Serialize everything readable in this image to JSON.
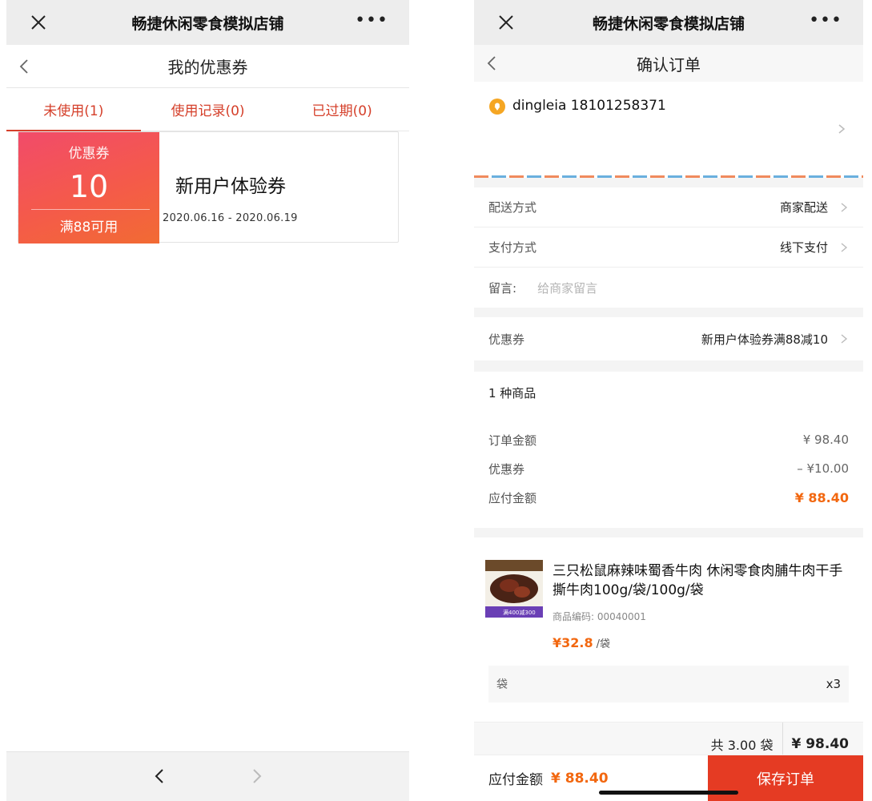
{
  "left": {
    "wx_title": "畅捷休闲零食模拟店铺",
    "more": "•••",
    "nav_title": "我的优惠券",
    "tabs": [
      {
        "label": "未使用(1)"
      },
      {
        "label": "使用记录(0)"
      },
      {
        "label": "已过期(0)"
      }
    ],
    "coupon": {
      "label": "优惠券",
      "amount": "10",
      "condition": "满88可用",
      "name": "新用户体验券",
      "date_range": "2020.06.16 - 2020.06.19"
    }
  },
  "right": {
    "wx_title": "畅捷休闲零食模拟店铺",
    "more": "•••",
    "nav_title": "确认订单",
    "address": {
      "who": "dingleia 18101258371"
    },
    "delivery": {
      "label": "配送方式",
      "value": "商家配送"
    },
    "payment": {
      "label": "支付方式",
      "value": "线下支付"
    },
    "message": {
      "label": "留言:",
      "placeholder": "给商家留言"
    },
    "coupon": {
      "label": "优惠券",
      "value": "新用户体验券满88减10"
    },
    "summary": {
      "count": "1 种商品",
      "rows": [
        {
          "label": "订单金额",
          "value": "¥ 98.40"
        },
        {
          "label": "优惠券",
          "value": "– ¥10.00"
        },
        {
          "label": "应付金额",
          "value": "¥ 88.40"
        }
      ]
    },
    "product": {
      "title": "三只松鼠麻辣味蜀香牛肉 休闲零食肉脯牛肉干手撕牛肉100g/袋/100g/袋",
      "code": "商品编码: 00040001",
      "price": "¥32.8",
      "unit": "/袋",
      "spec": "袋",
      "qty": "x3",
      "thumb_badge": "满400减300"
    },
    "total": {
      "count": "共 3.00 袋",
      "sum": "¥ 98.40"
    },
    "footer": {
      "label": "应付金额",
      "amount": "¥ 88.40",
      "save": "保存订单"
    }
  },
  "colors": {
    "accent_red": "#d5402b",
    "price_orange": "#f2670f",
    "save_button": "#e53b23"
  }
}
